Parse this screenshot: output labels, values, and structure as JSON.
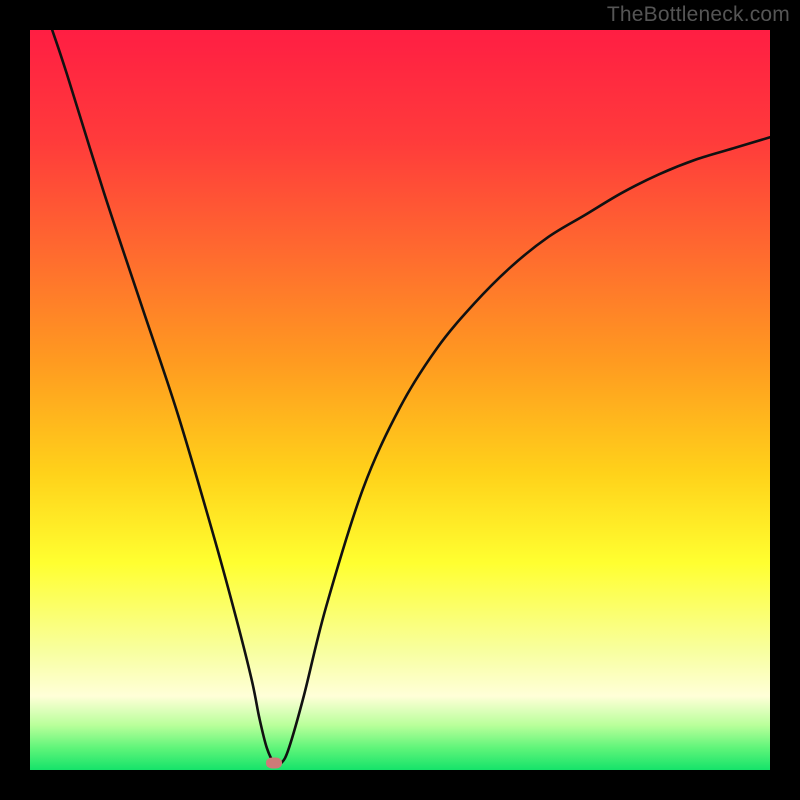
{
  "watermark": "TheBottleneck.com",
  "accent_marker": "#cd7a78",
  "curve_color": "#111111",
  "gradient_stops": [
    {
      "offset": 0.0,
      "color": "#ff1e43"
    },
    {
      "offset": 0.15,
      "color": "#ff3b3b"
    },
    {
      "offset": 0.3,
      "color": "#ff6a2f"
    },
    {
      "offset": 0.45,
      "color": "#ff9b20"
    },
    {
      "offset": 0.6,
      "color": "#ffd21a"
    },
    {
      "offset": 0.72,
      "color": "#ffff30"
    },
    {
      "offset": 0.84,
      "color": "#f8ffa0"
    },
    {
      "offset": 0.9,
      "color": "#ffffd8"
    },
    {
      "offset": 0.94,
      "color": "#b8ff9a"
    },
    {
      "offset": 0.97,
      "color": "#60f57a"
    },
    {
      "offset": 1.0,
      "color": "#15e36a"
    }
  ],
  "chart_data": {
    "type": "line",
    "title": "",
    "xlabel": "",
    "ylabel": "",
    "xlim": [
      0,
      100
    ],
    "ylim": [
      0,
      100
    ],
    "grid": false,
    "legend": false,
    "series": [
      {
        "name": "bottleneck-curve",
        "x": [
          3,
          5,
          10,
          15,
          20,
          25,
          28,
          30,
          31,
          32,
          33,
          34,
          35,
          37,
          40,
          45,
          50,
          55,
          60,
          65,
          70,
          75,
          80,
          85,
          90,
          95,
          100
        ],
        "y": [
          100,
          94,
          78,
          63,
          48,
          31,
          20,
          12,
          7,
          3,
          1,
          1,
          3,
          10,
          22,
          38,
          49,
          57,
          63,
          68,
          72,
          75,
          78,
          80.5,
          82.5,
          84,
          85.5
        ]
      }
    ],
    "marker": {
      "x": 33,
      "y": 1
    },
    "notes": "x/y are normalized 0–100 (percent of plot area). y=0 is bottom (green), y=100 is top (red). Curve has its minimum near x≈33."
  }
}
